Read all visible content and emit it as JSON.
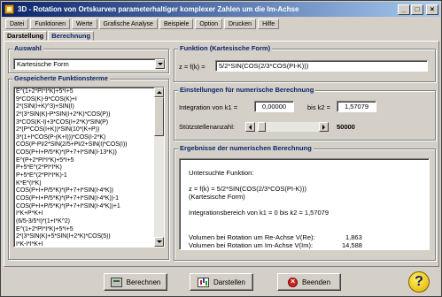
{
  "window": {
    "title": "3D - Rotation von Ortskurven parameterhaltiger komplexer Zahlen um die Im-Achse",
    "minimize": "_",
    "maximize": "□",
    "close": "×"
  },
  "menu": {
    "items": [
      "Datei",
      "Funktionen",
      "Werte",
      "Grafische Analyse",
      "Beispiele",
      "Option",
      "Drucken",
      "Hilfe"
    ]
  },
  "tabs": [
    {
      "label": "Darstellung",
      "active": false
    },
    {
      "label": "Berechnung",
      "active": true
    }
  ],
  "auswahl": {
    "title": "Auswahl",
    "selected": "Kartesische Form"
  },
  "gespeicherte": {
    "title": "Gespeicherte Funktionsterme",
    "items": [
      "E^(1+2*PI*I*K)+5*I+5",
      "9*COS(K)-9*COS(K)+I",
      "2*(SIN(I+K)^3)+SIN(I)",
      "2*(3*SIN(K)-P*SIN(I+2*K)*COS(P))",
      "3*COS(K-I)+3*COS(I+2*K)*SIN(P)",
      "2*(P*COS(I+K))*SIN(10*(K+P))",
      "3*(1+I*COS(P-(K+I)))*COS(I-2*K)",
      "COS(P-PI/2*SIN(2/5+PI/2+SIN(I)*COS(I))",
      "COS(P+I+P/5*K)*(P+7+I*SIN(I-13*K))",
      "E^(P+2*PI*I*K)+5*I+5",
      "P+5*E^(2*PI*I*K)",
      "P+5*E^(2*PI*I*K)-1",
      "K*E^(I*K)",
      "COS(P+I+P/5*K)*(P+7+I*SIN(I-4*K))",
      "COS(P+I+P/5*K)*(P+7+I*SIN(I-4*K))-1",
      "COS(P+I+P/5*K)*(P+7+I*SIN(I-4*K))+1",
      "I*K+P*K+I",
      "(6/5-3/5*I)*(1+I*K^2)",
      "E^(1+2*PI*I*K)+5*I+5",
      "2*(3*SIN(K)+5*SIN(I+2*K)*COS(5))",
      "I*K-I*I*K+I"
    ]
  },
  "funktion": {
    "title": "Funktion (Kartesische Form)",
    "prefix": "z = f(k) =",
    "term": "5/2*SIN(COS(2/3*COS(PI-K)))"
  },
  "einstellungen": {
    "title": "Einstellungen für numerische Berechnung",
    "integration_label": "Integration von k1 =",
    "k1": "0,00000",
    "bis_label": "bis k2 =",
    "k2": "1,57079",
    "stuetz_label": "Stützstellenanzahl:",
    "stuetz_value": "50000",
    "stuetz_fraction": 0.05
  },
  "ergebnisse": {
    "title": "Ergebnisse der numerischen Berechnung",
    "line1": "Untersuchte Funktion:",
    "line2": "z = f(k) = 5/2*SIN(COS(2/3*COS(PI-K)))",
    "line3": "(Kartesische Form)",
    "line4": "Integrationsbereich von k1 = 0 bis k2 = 1,57079",
    "vol_re_label": "Volumen bei Rotation um Re-Achse V(Re):",
    "vol_re_value": "1,863",
    "vol_im_label": "Volumen bei Rotation um Im-Achse V(Im):",
    "vol_im_value": "14,588"
  },
  "buttons": {
    "berechnen": "Berechnen",
    "darstellen": "Darstellen",
    "beenden": "Beenden",
    "help": "?"
  }
}
